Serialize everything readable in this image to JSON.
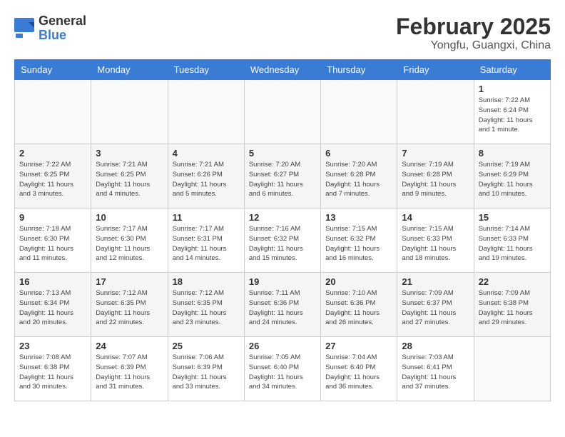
{
  "header": {
    "logo_general": "General",
    "logo_blue": "Blue",
    "month_year": "February 2025",
    "location": "Yongfu, Guangxi, China"
  },
  "days_of_week": [
    "Sunday",
    "Monday",
    "Tuesday",
    "Wednesday",
    "Thursday",
    "Friday",
    "Saturday"
  ],
  "weeks": [
    {
      "shade": false,
      "days": [
        {
          "num": "",
          "info": ""
        },
        {
          "num": "",
          "info": ""
        },
        {
          "num": "",
          "info": ""
        },
        {
          "num": "",
          "info": ""
        },
        {
          "num": "",
          "info": ""
        },
        {
          "num": "",
          "info": ""
        },
        {
          "num": "1",
          "info": "Sunrise: 7:22 AM\nSunset: 6:24 PM\nDaylight: 11 hours\nand 1 minute."
        }
      ]
    },
    {
      "shade": true,
      "days": [
        {
          "num": "2",
          "info": "Sunrise: 7:22 AM\nSunset: 6:25 PM\nDaylight: 11 hours\nand 3 minutes."
        },
        {
          "num": "3",
          "info": "Sunrise: 7:21 AM\nSunset: 6:25 PM\nDaylight: 11 hours\nand 4 minutes."
        },
        {
          "num": "4",
          "info": "Sunrise: 7:21 AM\nSunset: 6:26 PM\nDaylight: 11 hours\nand 5 minutes."
        },
        {
          "num": "5",
          "info": "Sunrise: 7:20 AM\nSunset: 6:27 PM\nDaylight: 11 hours\nand 6 minutes."
        },
        {
          "num": "6",
          "info": "Sunrise: 7:20 AM\nSunset: 6:28 PM\nDaylight: 11 hours\nand 7 minutes."
        },
        {
          "num": "7",
          "info": "Sunrise: 7:19 AM\nSunset: 6:28 PM\nDaylight: 11 hours\nand 9 minutes."
        },
        {
          "num": "8",
          "info": "Sunrise: 7:19 AM\nSunset: 6:29 PM\nDaylight: 11 hours\nand 10 minutes."
        }
      ]
    },
    {
      "shade": false,
      "days": [
        {
          "num": "9",
          "info": "Sunrise: 7:18 AM\nSunset: 6:30 PM\nDaylight: 11 hours\nand 11 minutes."
        },
        {
          "num": "10",
          "info": "Sunrise: 7:17 AM\nSunset: 6:30 PM\nDaylight: 11 hours\nand 12 minutes."
        },
        {
          "num": "11",
          "info": "Sunrise: 7:17 AM\nSunset: 6:31 PM\nDaylight: 11 hours\nand 14 minutes."
        },
        {
          "num": "12",
          "info": "Sunrise: 7:16 AM\nSunset: 6:32 PM\nDaylight: 11 hours\nand 15 minutes."
        },
        {
          "num": "13",
          "info": "Sunrise: 7:15 AM\nSunset: 6:32 PM\nDaylight: 11 hours\nand 16 minutes."
        },
        {
          "num": "14",
          "info": "Sunrise: 7:15 AM\nSunset: 6:33 PM\nDaylight: 11 hours\nand 18 minutes."
        },
        {
          "num": "15",
          "info": "Sunrise: 7:14 AM\nSunset: 6:33 PM\nDaylight: 11 hours\nand 19 minutes."
        }
      ]
    },
    {
      "shade": true,
      "days": [
        {
          "num": "16",
          "info": "Sunrise: 7:13 AM\nSunset: 6:34 PM\nDaylight: 11 hours\nand 20 minutes."
        },
        {
          "num": "17",
          "info": "Sunrise: 7:12 AM\nSunset: 6:35 PM\nDaylight: 11 hours\nand 22 minutes."
        },
        {
          "num": "18",
          "info": "Sunrise: 7:12 AM\nSunset: 6:35 PM\nDaylight: 11 hours\nand 23 minutes."
        },
        {
          "num": "19",
          "info": "Sunrise: 7:11 AM\nSunset: 6:36 PM\nDaylight: 11 hours\nand 24 minutes."
        },
        {
          "num": "20",
          "info": "Sunrise: 7:10 AM\nSunset: 6:36 PM\nDaylight: 11 hours\nand 26 minutes."
        },
        {
          "num": "21",
          "info": "Sunrise: 7:09 AM\nSunset: 6:37 PM\nDaylight: 11 hours\nand 27 minutes."
        },
        {
          "num": "22",
          "info": "Sunrise: 7:09 AM\nSunset: 6:38 PM\nDaylight: 11 hours\nand 29 minutes."
        }
      ]
    },
    {
      "shade": false,
      "days": [
        {
          "num": "23",
          "info": "Sunrise: 7:08 AM\nSunset: 6:38 PM\nDaylight: 11 hours\nand 30 minutes."
        },
        {
          "num": "24",
          "info": "Sunrise: 7:07 AM\nSunset: 6:39 PM\nDaylight: 11 hours\nand 31 minutes."
        },
        {
          "num": "25",
          "info": "Sunrise: 7:06 AM\nSunset: 6:39 PM\nDaylight: 11 hours\nand 33 minutes."
        },
        {
          "num": "26",
          "info": "Sunrise: 7:05 AM\nSunset: 6:40 PM\nDaylight: 11 hours\nand 34 minutes."
        },
        {
          "num": "27",
          "info": "Sunrise: 7:04 AM\nSunset: 6:40 PM\nDaylight: 11 hours\nand 36 minutes."
        },
        {
          "num": "28",
          "info": "Sunrise: 7:03 AM\nSunset: 6:41 PM\nDaylight: 11 hours\nand 37 minutes."
        },
        {
          "num": "",
          "info": ""
        }
      ]
    }
  ]
}
